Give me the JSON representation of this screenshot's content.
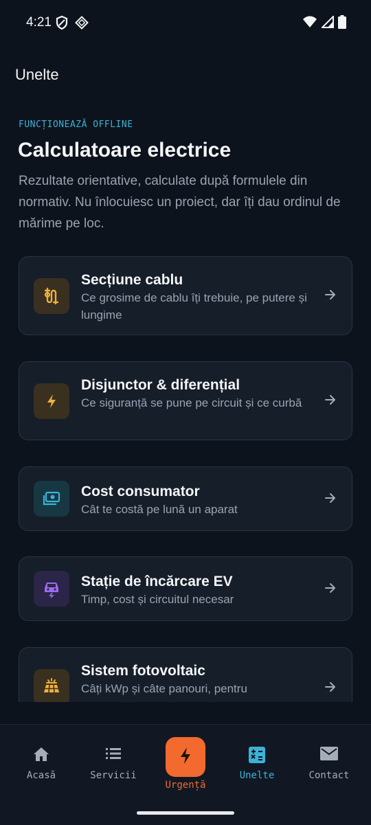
{
  "status_bar": {
    "time": "4:21"
  },
  "header": {
    "title": "Unelte"
  },
  "intro": {
    "eyebrow": "FUNCȚIONEAZĂ OFFLINE",
    "title": "Calculatoare electrice",
    "description": "Rezultate orientative, calculate după formulele din normativ. Nu înlocuiesc un proiect, dar îți dau ordinul de mărime pe loc."
  },
  "tools": [
    {
      "title": "Secțiune cablu",
      "subtitle": "Ce grosime de cablu îți trebuie, pe putere și lungime",
      "icon": "cable-icon",
      "color": "#f0b13b"
    },
    {
      "title": "Disjunctor & diferențial",
      "subtitle": "Ce siguranță se pune pe circuit și ce curbă",
      "icon": "bolt-icon",
      "color": "#f0b13b"
    },
    {
      "title": "Cost consumator",
      "subtitle": "Cât te costă pe lună un aparat",
      "icon": "money-icon",
      "color": "#3bb3d6"
    },
    {
      "title": "Stație de încărcare EV",
      "subtitle": "Timp, cost și circuitul necesar",
      "icon": "ev-car-icon",
      "color": "#9b6cf0"
    },
    {
      "title": "Sistem fotovoltaic",
      "subtitle": "Câți kWp și câte panouri, pentru",
      "icon": "solar-panel-icon",
      "color": "#f0b13b"
    }
  ],
  "bottom_nav": {
    "items": [
      {
        "label": "Acasă",
        "icon": "home-icon"
      },
      {
        "label": "Servicii",
        "icon": "list-icon"
      },
      {
        "label": "Urgență",
        "icon": "bolt-icon",
        "accent": "#f26a2e"
      },
      {
        "label": "Unelte",
        "icon": "calculator-icon",
        "accent": "#3bb3d6",
        "active": true
      },
      {
        "label": "Contact",
        "icon": "mail-icon"
      }
    ]
  }
}
